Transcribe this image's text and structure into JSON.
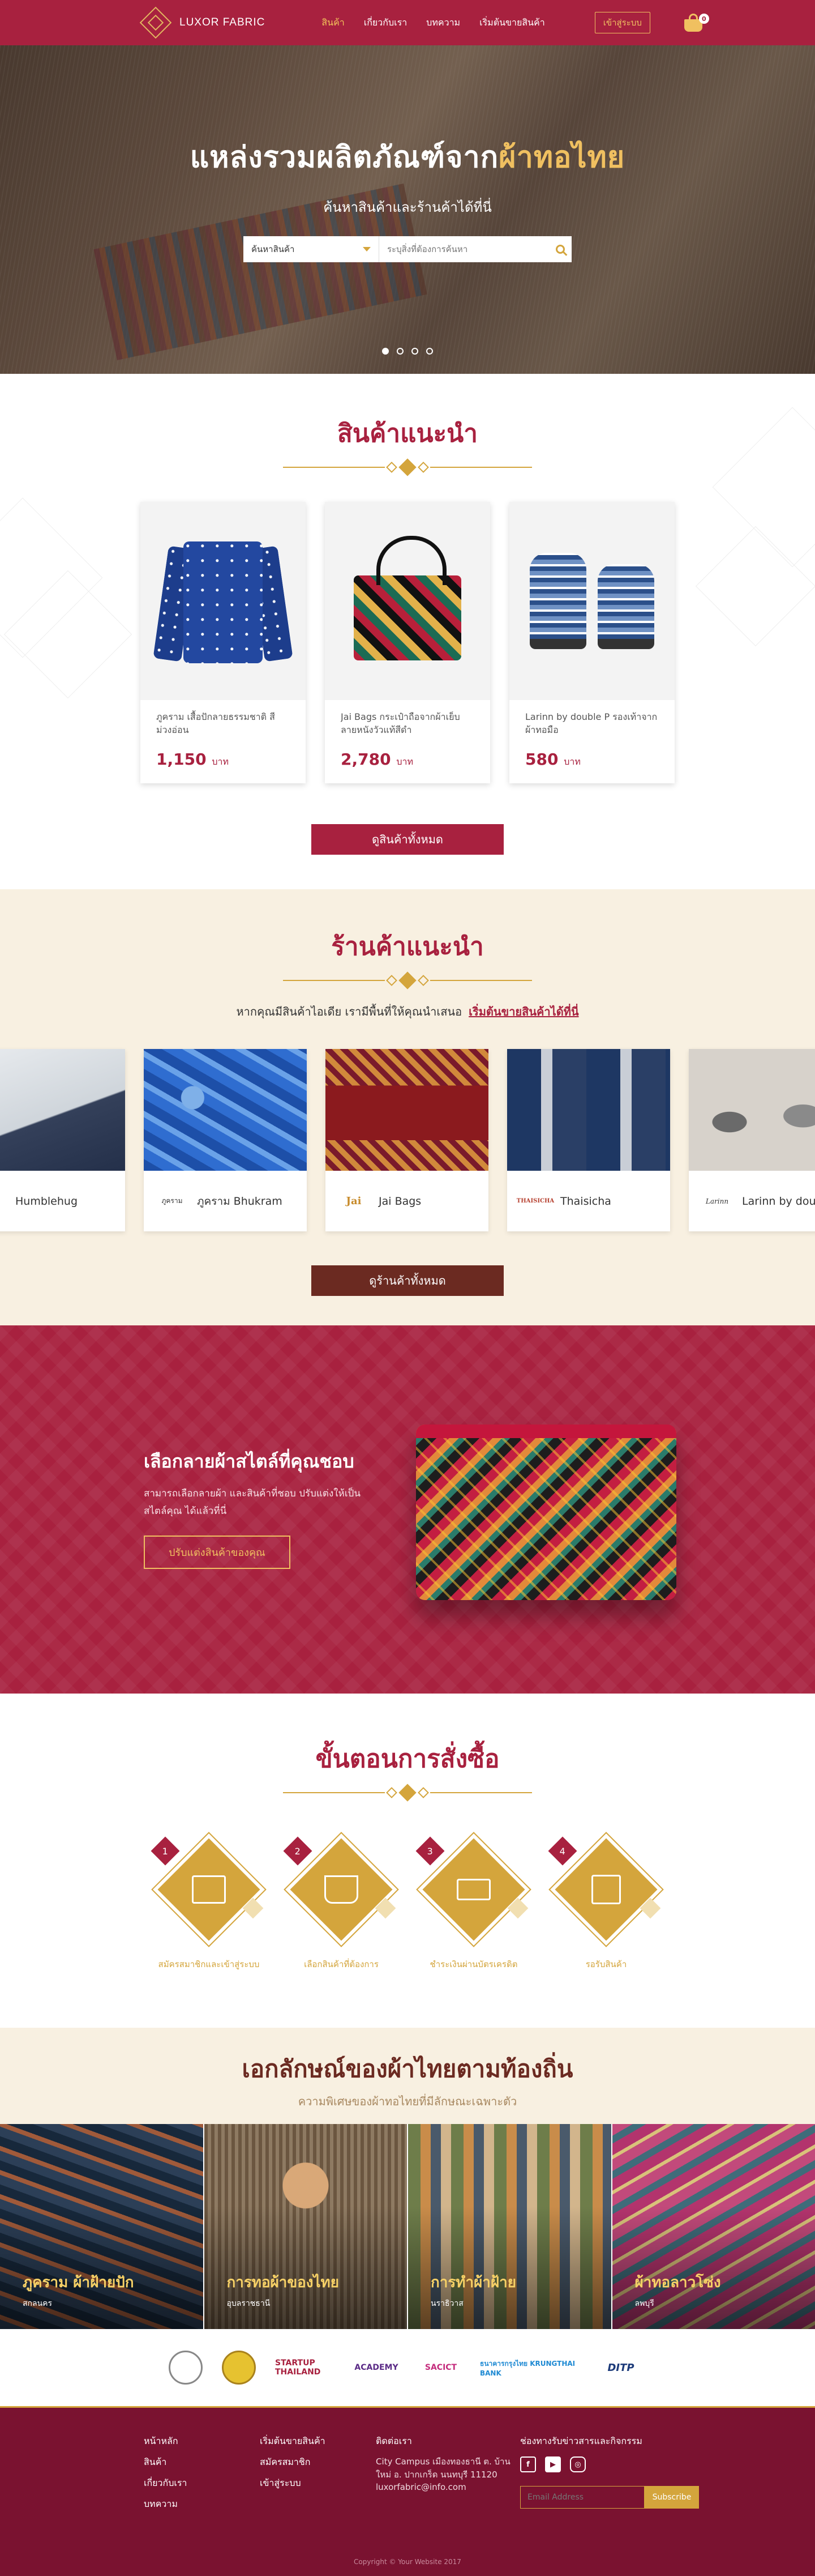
{
  "nav": {
    "brand": "LUXOR FABRIC",
    "menu": [
      "สินค้า",
      "เกี่ยวกับเรา",
      "บทความ",
      "เริ่มต้นขายสินค้า"
    ],
    "active_index": 0,
    "login": "เข้าสู่ระบบ",
    "cart_count": "0"
  },
  "hero": {
    "title_main": "แหล่งรวมผลิตภัณฑ์จาก",
    "title_highlight": "ผ้าทอไทย",
    "subtitle": "ค้นหาสินค้าและร้านค้าได้ที่นี่",
    "category_label": "ค้นหาสินค้า",
    "search_placeholder": "ระบุสิ่งที่ต้องการค้นหา",
    "slide_count": 4,
    "active_slide": 0
  },
  "products": {
    "title": "สินค้าแนะนำ",
    "items": [
      {
        "name": "ภูคราม เสื้อปักลายธรรมชาติ สีม่วงอ่อน",
        "price": "1,150",
        "unit": "บาท",
        "image": "jacket-image"
      },
      {
        "name": "Jai Bags กระเป๋าถือจากผ้าเย็บลายหนังวัวแท้สีดำ",
        "price": "2,780",
        "unit": "บาท",
        "image": "bag-image"
      },
      {
        "name": "Larinn by double P รองเท้าจากผ้าทอมือ",
        "price": "580",
        "unit": "บาท",
        "image": "sandal-image"
      }
    ],
    "view_all": "ดูสินค้าทั้งหมด"
  },
  "shops": {
    "title": "ร้านค้าแนะนำ",
    "subtitle": "หากคุณมีสินค้าไอเดีย เรามีพื้นที่ให้คุณนำเสนอ",
    "subtitle_link": "เริ่มต้นขายสินค้าได้ที่นี่",
    "items": [
      {
        "name": "Humblehug",
        "logo": ""
      },
      {
        "name": "ภูคราม Bhukram",
        "logo": "ภูคราม"
      },
      {
        "name": "Jai Bags",
        "logo": "Jai"
      },
      {
        "name": "Thaisicha",
        "logo": "THAISICHA"
      },
      {
        "name": "Larinn by doublep",
        "logo": "Larinn"
      }
    ],
    "view_all": "ดูร้านค้าทั้งหมด"
  },
  "custom": {
    "title": "เลือกลายผ้าสไตล์ที่คุณชอบ",
    "desc": "สามารถเลือกลายผ้า และสินค้าที่ชอบ ปรับแต่งให้เป็นสไตล์คุณ ได้แล้วที่นี่",
    "button": "ปรับแต่งสินค้าของคุณ"
  },
  "steps": {
    "title": "ขั้นตอนการสั่งซื้อ",
    "items": [
      {
        "num": "1",
        "label": "สมัครสมาชิกและเข้าสู่ระบบ"
      },
      {
        "num": "2",
        "label": "เลือกสินค้าที่ต้องการ"
      },
      {
        "num": "3",
        "label": "ชำระเงินผ่านบัตรเครดิต"
      },
      {
        "num": "4",
        "label": "รอรับสินค้า"
      }
    ]
  },
  "identity": {
    "title": "เอกลักษณ์ของผ้าไทยตามท้องถิ่น",
    "subtitle": "ความพิเศษของผ้าทอไทยที่มีลักษณะเฉพาะตัว",
    "items": [
      {
        "title": "ภูคราม ผ้าฝ้ายปัก",
        "place": "สกลนคร"
      },
      {
        "title": "การทอผ้าของไทย",
        "place": "อุบลราชธานี"
      },
      {
        "title": "การทำผ้าฝ้าย",
        "place": "นราธิวาส"
      },
      {
        "title": "ผ้าทอลาวโซ่ง",
        "place": "ลพบุรี"
      }
    ]
  },
  "partners": [
    "STARTUP THAILAND",
    "ACADEMY",
    "SACICT",
    "ธนาคารกรุงไทย KRUNGTHAI BANK",
    "DITP"
  ],
  "footer": {
    "col1": [
      "หน้าหลัก",
      "สินค้า",
      "เกี่ยวกับเรา",
      "บทความ"
    ],
    "col2": [
      "เริ่มต้นขายสินค้า",
      "สมัครสมาชิก",
      "เข้าสู่ระบบ"
    ],
    "contact_title": "ติดต่อเรา",
    "contact_addr": "City Campus เมืองทองธานี ต. บ้านใหม่ อ. ปากเกร็ด นนทบุรี 11120",
    "contact_email": "luxorfabric@info.com",
    "news_title": "ช่องทางรับข่าวสารและกิจกรรม",
    "email_placeholder": "Email Address",
    "subscribe": "Subscribe",
    "copyright": "Copyright © Your Website 2017"
  }
}
